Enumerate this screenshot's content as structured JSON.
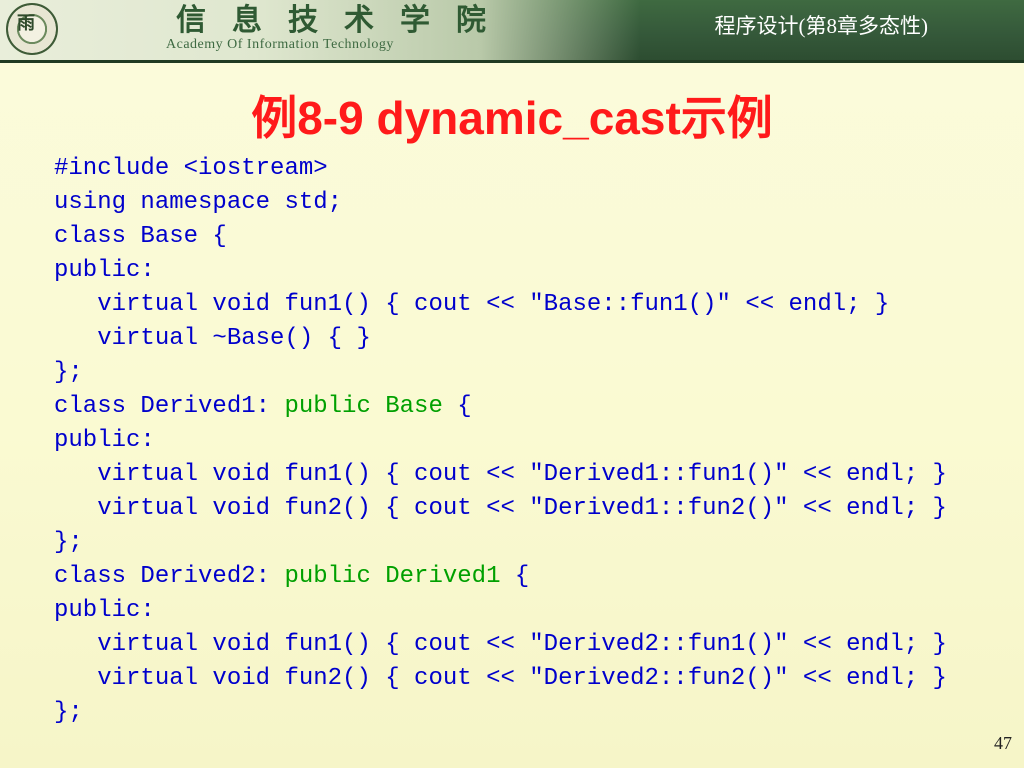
{
  "header": {
    "logo_glyph": "雨",
    "academy_cn": "信息技术学院",
    "academy_en": "Academy Of Information Technology",
    "course_title": "程序设计(第8章多态性)"
  },
  "slide": {
    "title": "例8-9 dynamic_cast示例",
    "page_number": "47"
  },
  "code": {
    "lines": [
      {
        "text": "#include <iostream>"
      },
      {
        "text": "using namespace std;"
      },
      {
        "text": "class Base {"
      },
      {
        "text": "public:"
      },
      {
        "text": "   virtual void fun1() { cout << \"Base::fun1()\" << endl; }"
      },
      {
        "text": "   virtual ~Base() { }"
      },
      {
        "text": "};"
      },
      {
        "pre": "class Derived1: ",
        "hl": "public Base",
        "post": " {"
      },
      {
        "text": "public:"
      },
      {
        "text": "   virtual void fun1() { cout << \"Derived1::fun1()\" << endl; }"
      },
      {
        "text": "   virtual void fun2() { cout << \"Derived1::fun2()\" << endl; }"
      },
      {
        "text": "};"
      },
      {
        "pre": "class Derived2: ",
        "hl": "public Derived1",
        "post": " {"
      },
      {
        "text": "public:"
      },
      {
        "text": "   virtual void fun1() { cout << \"Derived2::fun1()\" << endl; }"
      },
      {
        "text": "   virtual void fun2() { cout << \"Derived2::fun2()\" << endl; }"
      },
      {
        "text": "};"
      }
    ]
  },
  "colors": {
    "title": "#ff1a1a",
    "code_text": "#0000cc",
    "code_highlight": "#00a000",
    "banner": "#3f6a41"
  }
}
